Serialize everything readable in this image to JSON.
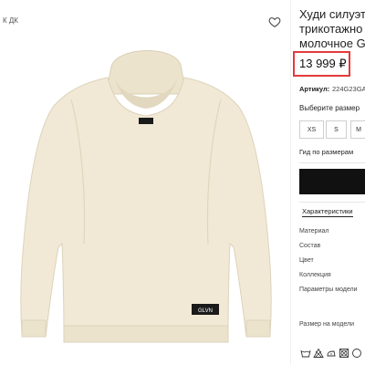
{
  "breadcrumb": "К ДК",
  "product": {
    "title_lines": [
      "Худи силуэт",
      "трикотажно",
      "молочное G"
    ],
    "price": "13 999 ₽",
    "article_label": "Артикул:",
    "article_value": "224G23GA"
  },
  "sizes": {
    "label": "Выберите размер",
    "options": [
      "XS",
      "S",
      "M"
    ],
    "guide": "Гид по размерам"
  },
  "tabs": {
    "characteristics": "Характеристики"
  },
  "attributes": [
    "Материал",
    "Состав",
    "Цвет",
    "Коллекция",
    "Параметры модели",
    "Размер на модели"
  ],
  "garment_label_text": "GLVN",
  "colors": {
    "accent_box": "#e43a3a",
    "hoodie": "#f1e9d5",
    "button": "#111111"
  },
  "icons": [
    "heart-icon",
    "wash-icon",
    "bleach-icon",
    "iron-icon",
    "tumble-dry-icon",
    "dry-clean-icon"
  ]
}
